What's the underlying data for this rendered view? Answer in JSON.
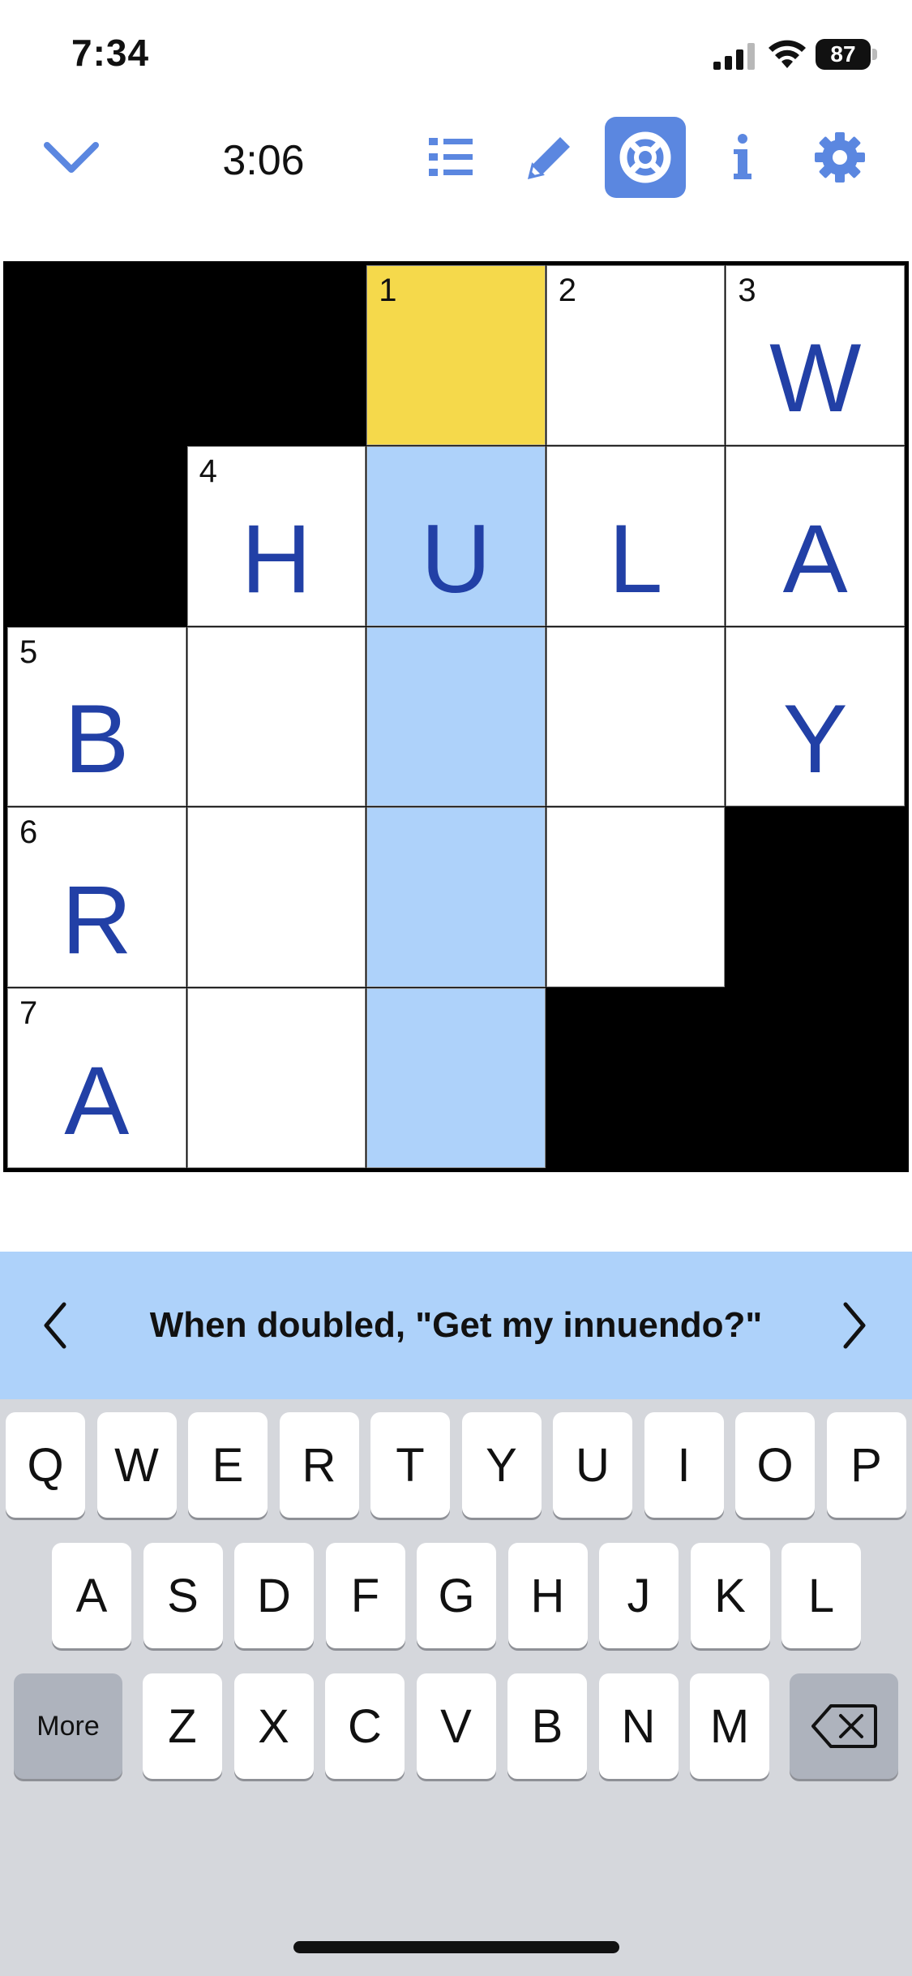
{
  "status_bar": {
    "time": "7:34",
    "battery": "87"
  },
  "toolbar": {
    "timer": "3:06",
    "icons": [
      "chevron-down-icon",
      "list-icon",
      "pencil-icon",
      "lifebuoy-icon",
      "info-icon",
      "gear-icon"
    ],
    "active_icon": "lifebuoy-icon",
    "accent_color": "#5b87e0"
  },
  "grid": {
    "size": 5,
    "cells": [
      [
        {
          "block": true
        },
        {
          "block": true
        },
        {
          "num": "1",
          "letter": "",
          "state": "active"
        },
        {
          "num": "2",
          "letter": ""
        },
        {
          "num": "3",
          "letter": "W"
        }
      ],
      [
        {
          "block": true
        },
        {
          "num": "4",
          "letter": "H"
        },
        {
          "num": "",
          "letter": "U",
          "state": "word"
        },
        {
          "num": "",
          "letter": "L"
        },
        {
          "num": "",
          "letter": "A"
        }
      ],
      [
        {
          "num": "5",
          "letter": "B"
        },
        {
          "num": "",
          "letter": ""
        },
        {
          "num": "",
          "letter": "",
          "state": "word"
        },
        {
          "num": "",
          "letter": ""
        },
        {
          "num": "",
          "letter": "Y"
        }
      ],
      [
        {
          "num": "6",
          "letter": "R"
        },
        {
          "num": "",
          "letter": ""
        },
        {
          "num": "",
          "letter": "",
          "state": "word"
        },
        {
          "num": "",
          "letter": ""
        },
        {
          "block": true
        }
      ],
      [
        {
          "num": "7",
          "letter": "A"
        },
        {
          "num": "",
          "letter": ""
        },
        {
          "num": "",
          "letter": "",
          "state": "word"
        },
        {
          "block": true
        },
        {
          "block": true
        }
      ]
    ],
    "colors": {
      "active": "#f5d94b",
      "word": "#aed2fa",
      "letter": "#2240a6"
    }
  },
  "clue": {
    "text": "When doubled, \"Get my innuendo?\""
  },
  "keyboard": {
    "row1": [
      "Q",
      "W",
      "E",
      "R",
      "T",
      "Y",
      "U",
      "I",
      "O",
      "P"
    ],
    "row2": [
      "A",
      "S",
      "D",
      "F",
      "G",
      "H",
      "J",
      "K",
      "L"
    ],
    "row3": [
      "Z",
      "X",
      "C",
      "V",
      "B",
      "N",
      "M"
    ],
    "more_label": "More",
    "delete_icon": "backspace-icon"
  }
}
